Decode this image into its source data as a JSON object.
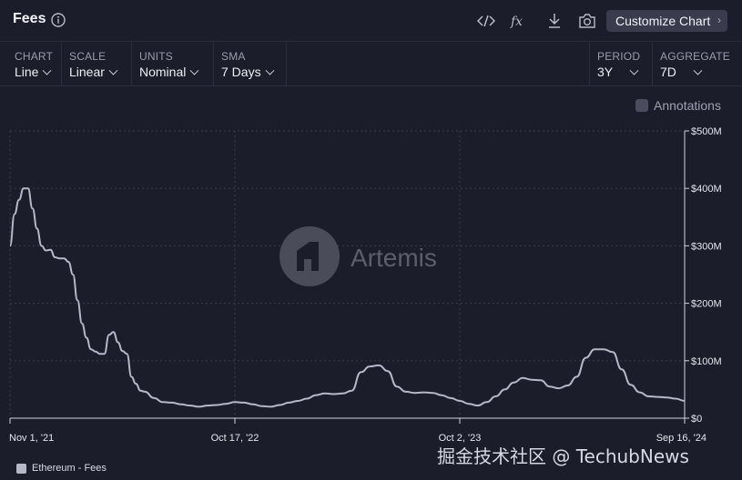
{
  "header": {
    "title": "Fees",
    "customize_label": "Customize Chart"
  },
  "controls": [
    {
      "label": "CHART",
      "value": "Line"
    },
    {
      "label": "SCALE",
      "value": "Linear"
    },
    {
      "label": "UNITS",
      "value": "Nominal"
    },
    {
      "label": "SMA",
      "value": "7 Days"
    },
    {
      "label": "PERIOD",
      "value": "3Y"
    },
    {
      "label": "AGGREGATE",
      "value": "7D"
    }
  ],
  "annotations_label": "Annotations",
  "brand_watermark": "Artemis",
  "source_watermark": "掘金技术社区 @ TechubNews",
  "chart_data": {
    "type": "line",
    "title": "Fees",
    "xlabel": "",
    "ylabel": "",
    "x_tick_labels": [
      "Nov 1, '21",
      "Oct 17, '22",
      "Oct 2, '23",
      "Sep 16, '24"
    ],
    "y_tick_labels": [
      "$0",
      "$100M",
      "$200M",
      "$300M",
      "$400M",
      "$500M"
    ],
    "ylim": [
      0,
      500
    ],
    "y_unit": "$M",
    "grid": true,
    "legend_position": "bottom-left",
    "series_color": "#b6b8c8",
    "series": [
      {
        "name": "Ethereum - Fees",
        "x": [
          "2021-11-01",
          "2021-11-08",
          "2021-11-15",
          "2021-11-22",
          "2021-11-29",
          "2021-12-06",
          "2021-12-13",
          "2021-12-20",
          "2021-12-27",
          "2022-01-03",
          "2022-01-10",
          "2022-01-17",
          "2022-01-24",
          "2022-01-31",
          "2022-02-07",
          "2022-02-14",
          "2022-02-21",
          "2022-02-28",
          "2022-03-07",
          "2022-03-14",
          "2022-03-21",
          "2022-03-28",
          "2022-04-04",
          "2022-04-11",
          "2022-04-18",
          "2022-04-25",
          "2022-05-02",
          "2022-05-09",
          "2022-05-16",
          "2022-05-23",
          "2022-05-30",
          "2022-06-13",
          "2022-06-27",
          "2022-07-11",
          "2022-07-25",
          "2022-08-08",
          "2022-08-22",
          "2022-09-05",
          "2022-09-19",
          "2022-10-03",
          "2022-10-17",
          "2022-10-31",
          "2022-11-14",
          "2022-11-28",
          "2022-12-12",
          "2022-12-26",
          "2023-01-09",
          "2023-01-23",
          "2023-02-06",
          "2023-02-20",
          "2023-03-06",
          "2023-03-20",
          "2023-04-03",
          "2023-04-17",
          "2023-05-01",
          "2023-05-15",
          "2023-05-29",
          "2023-06-12",
          "2023-06-26",
          "2023-07-10",
          "2023-07-24",
          "2023-08-07",
          "2023-08-21",
          "2023-09-04",
          "2023-09-18",
          "2023-10-02",
          "2023-10-16",
          "2023-10-30",
          "2023-11-13",
          "2023-11-27",
          "2023-12-11",
          "2023-12-25",
          "2024-01-08",
          "2024-01-22",
          "2024-02-05",
          "2024-02-19",
          "2024-03-04",
          "2024-03-18",
          "2024-04-01",
          "2024-04-15",
          "2024-04-29",
          "2024-05-13",
          "2024-05-27",
          "2024-06-10",
          "2024-06-24",
          "2024-07-08",
          "2024-07-22",
          "2024-08-05",
          "2024-08-19",
          "2024-09-02",
          "2024-09-16"
        ],
        "values": [
          300,
          355,
          380,
          400,
          400,
          365,
          330,
          300,
          292,
          293,
          280,
          278,
          278,
          272,
          250,
          205,
          165,
          140,
          120,
          116,
          112,
          112,
          145,
          150,
          132,
          117,
          112,
          72,
          60,
          48,
          46,
          35,
          28,
          27,
          24,
          22,
          20,
          22,
          23,
          25,
          28,
          27,
          24,
          21,
          20,
          23,
          27,
          30,
          34,
          40,
          43,
          42,
          43,
          48,
          80,
          90,
          92,
          82,
          55,
          46,
          44,
          45,
          44,
          40,
          35,
          30,
          25,
          22,
          28,
          38,
          50,
          62,
          70,
          67,
          66,
          55,
          52,
          57,
          72,
          105,
          120,
          120,
          115,
          85,
          58,
          45,
          38,
          37,
          36,
          34,
          30
        ]
      }
    ]
  }
}
